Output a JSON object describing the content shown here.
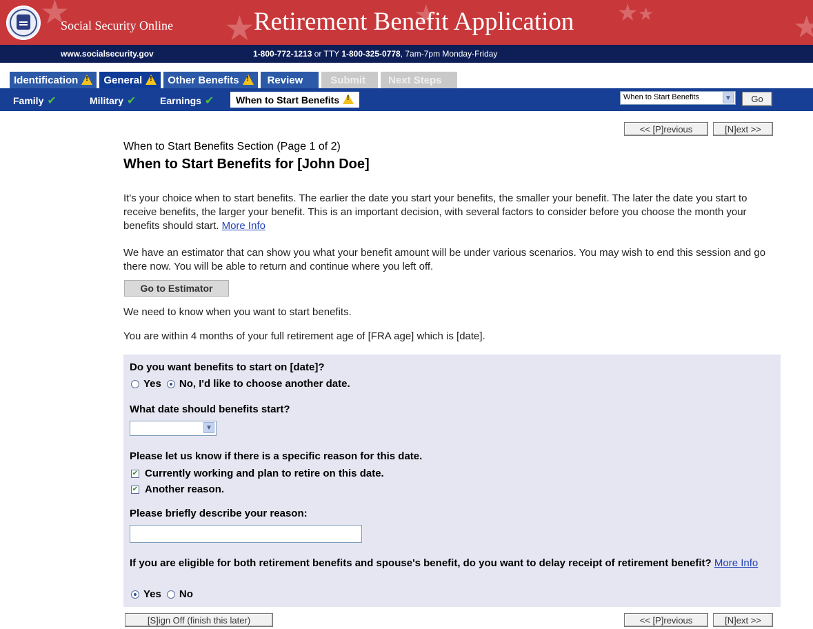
{
  "banner": {
    "brand": "Social Security Online",
    "app_title": "Retirement Benefit Application",
    "url": "www.socialsecurity.gov",
    "phone_number": "1-800-772-1213",
    "phone_or_tty": " or TTY ",
    "tty_number": "1-800-325-0778",
    "hours": ", 7am-7pm Monday-Friday"
  },
  "tabs": [
    {
      "label": "Identification",
      "warning": true,
      "state": "normal"
    },
    {
      "label": "General",
      "warning": true,
      "state": "active"
    },
    {
      "label": "Other Benefits",
      "warning": true,
      "state": "normal"
    },
    {
      "label": "Review",
      "warning": false,
      "state": "normal"
    },
    {
      "label": "Submit",
      "warning": false,
      "state": "disabled"
    },
    {
      "label": "Next Steps",
      "warning": false,
      "state": "disabled"
    }
  ],
  "subnav": {
    "items": [
      {
        "label": "Family",
        "complete": true
      },
      {
        "label": "Military",
        "complete": true
      },
      {
        "label": "Earnings",
        "complete": true
      }
    ],
    "current": "When to Start Benefits",
    "jump_select_value": "When to Start Benefits",
    "go_label": "Go"
  },
  "nav_buttons": {
    "previous": "<< [P]revious",
    "next": "[N]ext >>",
    "sign_off": "[S]ign Off (finish this later)"
  },
  "page": {
    "section_label": "When to Start Benefits Section (Page 1 of 2)",
    "title": "When to Start Benefits for [John Doe]",
    "intro": "It's your choice when to start benefits. The earlier the date you start your benefits, the smaller your benefit. The later the date you start to receive benefits, the larger your benefit. This is an important decision, with several factors to consider before you choose the month your benefits should start. ",
    "more_info": "More Info",
    "estimator_text": "We have an estimator that can show you what your benefit amount will be under various scenarios. You may wish to end this session and go there now. You will be able to return and continue where you left off.",
    "estimator_button": "Go to Estimator",
    "need_to_know": "We need to know when you want to start benefits.",
    "within_fra": "You are within 4 months of your full retirement age of [FRA age] which is [date]."
  },
  "form": {
    "q_start_date": "Do you want benefits to start on [date]?",
    "opt_yes": "Yes",
    "opt_no_choose": "No, I'd like to choose another date.",
    "start_selected": "no",
    "q_what_date": "What date should benefits start?",
    "date_value": "",
    "q_reason": "Please let us know if there is a specific reason for this date.",
    "reason_working": "Currently working and plan to retire on this date.",
    "reason_working_checked": true,
    "reason_another": "Another reason.",
    "reason_another_checked": true,
    "q_describe": "Please briefly describe your reason:",
    "describe_value": "",
    "q_delay": "If you are eligible for both retirement benefits and spouse's benefit, do you want to delay receipt of retirement benefit? ",
    "delay_more_info": "More Info",
    "delay_yes": "Yes",
    "delay_no": "No",
    "delay_selected": "yes"
  },
  "icons": {
    "warning": "warning-icon",
    "check": "check-icon",
    "dropdown": "chevron-down-icon"
  },
  "colors": {
    "banner_red": "#c8373a",
    "banner_navy": "#0e1f58",
    "tab_blue": "#2c5aa8",
    "subnav_blue": "#173f95",
    "panel_lavender": "#e6e6f2",
    "warning_yellow": "#f4c21b",
    "check_green": "#4cbf3a"
  }
}
